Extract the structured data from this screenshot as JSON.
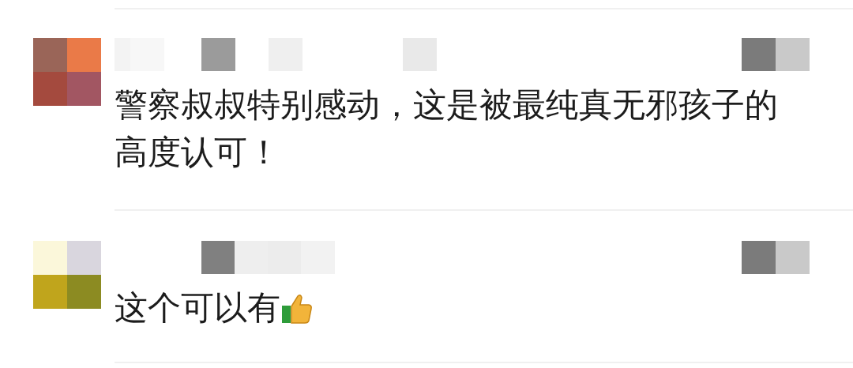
{
  "comments": [
    {
      "text": "警察叔叔特别感动，这是被最纯真无邪孩子的高度认可！",
      "thumbs_up": false
    },
    {
      "text": "这个可以有",
      "thumbs_up": true
    }
  ]
}
